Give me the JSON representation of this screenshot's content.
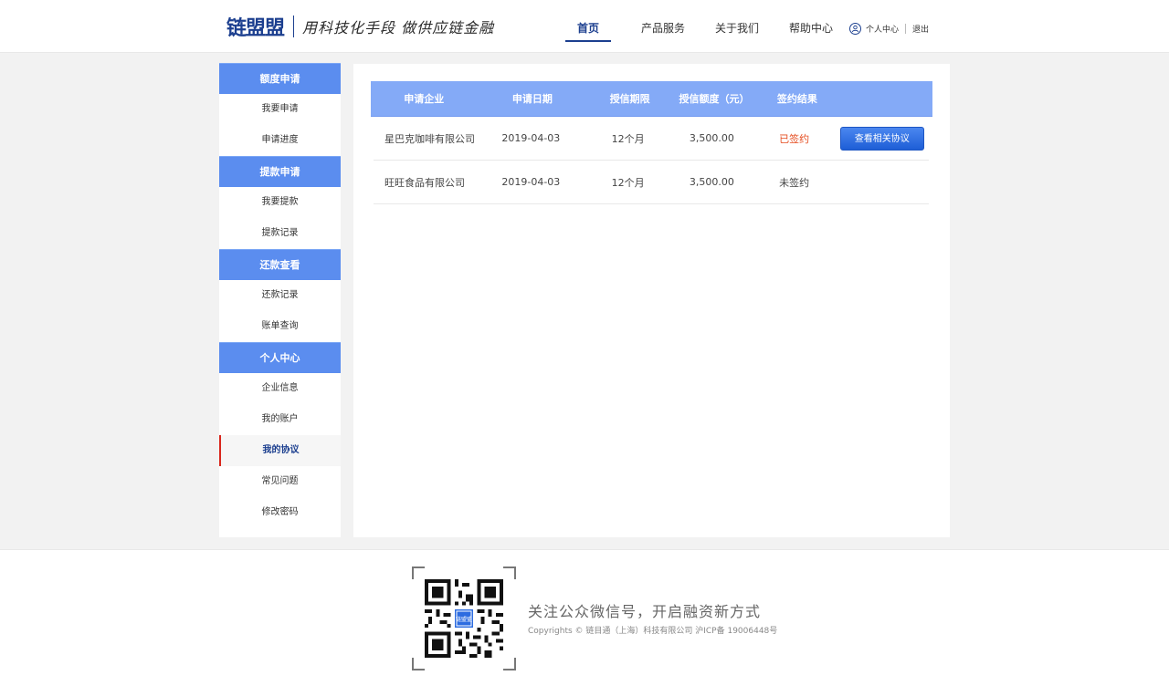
{
  "header": {
    "logo_text": "链盟盟",
    "slogan": "用科技化手段 做供应链金融",
    "nav": [
      "首页",
      "产品服务",
      "关于我们",
      "帮助中心"
    ],
    "user_center": "个人中心",
    "logout": "退出"
  },
  "sidebar": {
    "groups": [
      {
        "title": "额度申请",
        "items": [
          "我要申请",
          "申请进度"
        ]
      },
      {
        "title": "提款申请",
        "items": [
          "我要提款",
          "提款记录"
        ]
      },
      {
        "title": "还款查看",
        "items": [
          "还款记录",
          "账单查询"
        ]
      },
      {
        "title": "个人中心",
        "items": [
          "企业信息",
          "我的账户",
          "我的协议",
          "常见问题",
          "修改密码"
        ]
      }
    ],
    "active_item": "我的协议"
  },
  "table": {
    "headers": [
      "申请企业",
      "申请日期",
      "授信期限",
      "授信额度（元）",
      "签约结果",
      ""
    ],
    "rows": [
      {
        "company": "星巴克咖啡有限公司",
        "date": "2019-04-03",
        "term": "12个月",
        "amount": "3,500.00",
        "status": "已签约",
        "action": "查看相关协议"
      },
      {
        "company": "旺旺食品有限公司",
        "date": "2019-04-03",
        "term": "12个月",
        "amount": "3,500.00",
        "status": "未签约",
        "action": ""
      }
    ]
  },
  "footer": {
    "qr_label": "链盟盟",
    "title": "关注公众微信号，开启融资新方式",
    "copyright": "Copyrights © 链目通（上海）科技有限公司 沪ICP备 19006448号"
  },
  "colors": {
    "brand": "#1c3f8f",
    "sidebar_header": "#5b8def",
    "table_header": "#84aaf7",
    "signed": "#e54c1f",
    "button": "#2d6ce0"
  }
}
